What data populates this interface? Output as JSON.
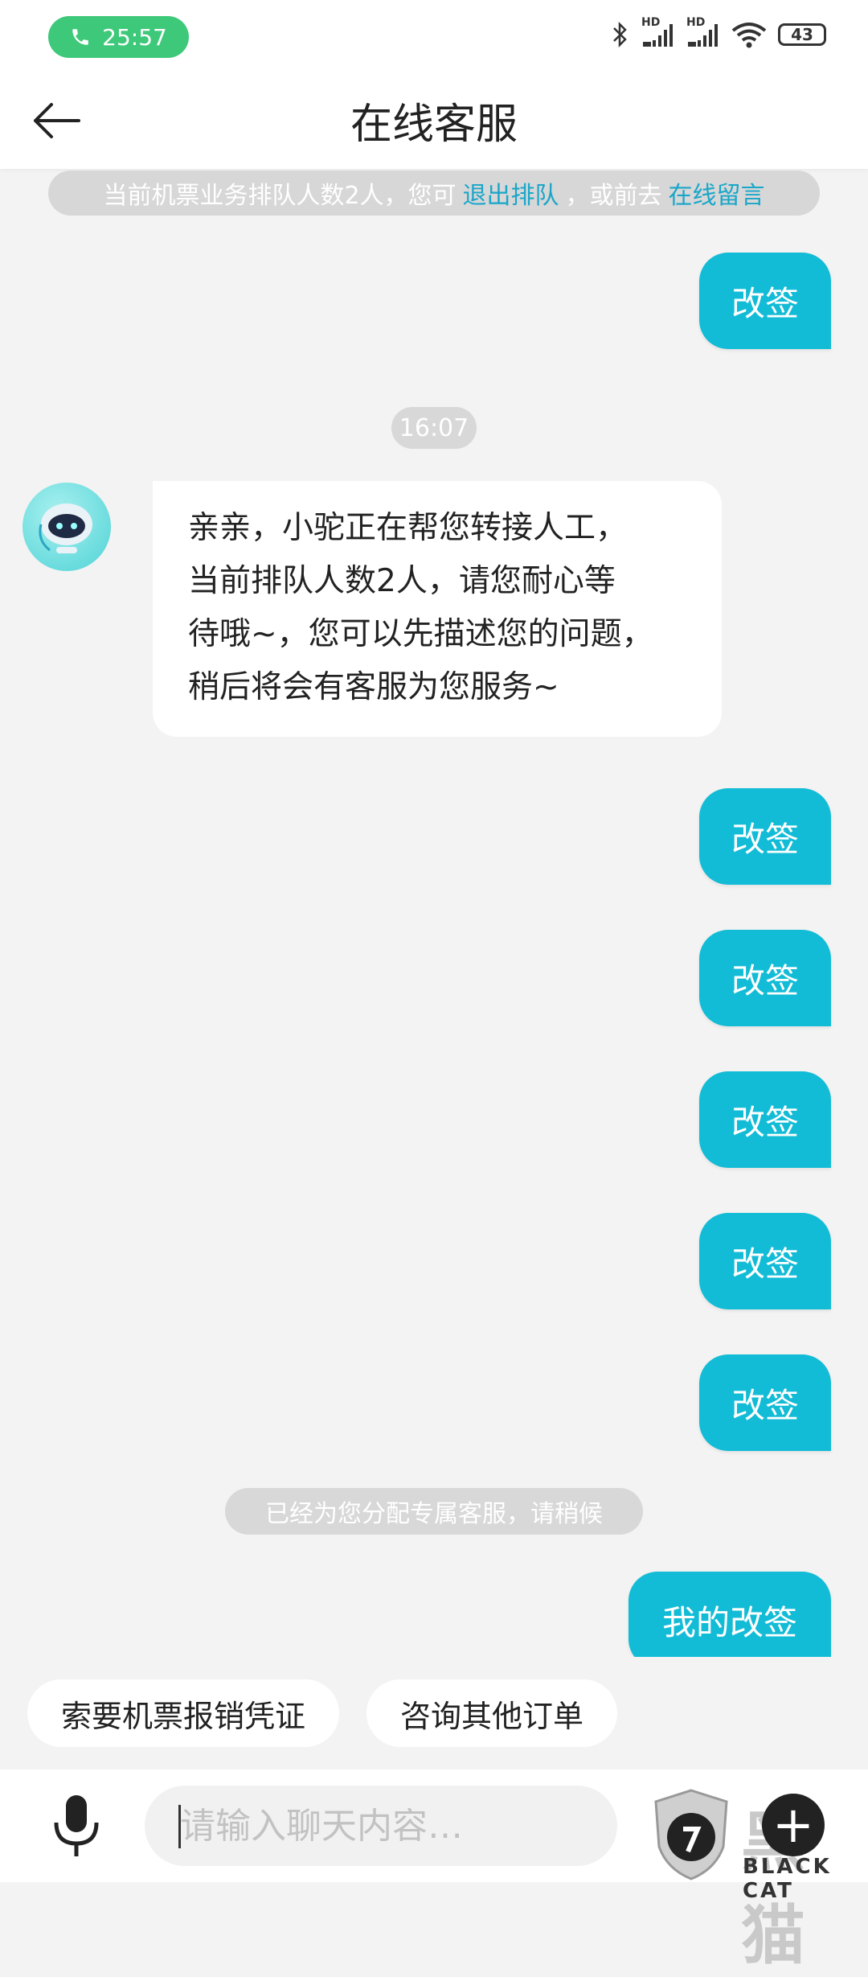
{
  "status_bar": {
    "call_time": "25:57",
    "signal_1": "HD",
    "signal_2": "HD",
    "battery": "43"
  },
  "header": {
    "title": "在线客服"
  },
  "queue_notice": {
    "text_prefix": "当前机票业务排队人数2人，您可",
    "exit_link": "退出排队",
    "text_middle": "，或前去",
    "message_link": "在线留言"
  },
  "messages": {
    "user_1": "改签",
    "timestamp": "16:07",
    "agent_lines": [
      "亲亲，小驼正在帮您转接人工，",
      "当前排队人数2人，请您耐心等",
      "待哦~，您可以先描述您的问题，",
      "稍后将会有客服为您服务~"
    ],
    "user_2": "改签",
    "user_3": "改签",
    "user_4": "改签",
    "user_5": "改签",
    "user_6": "改签",
    "system_notice": "已经为您分配专属客服，请稍候",
    "user_7": "我的改签"
  },
  "quick_replies": [
    "索要机票报销凭证",
    "咨询其他订单"
  ],
  "input": {
    "placeholder": "请输入聊天内容…"
  },
  "watermark": {
    "text": "黑猫",
    "sub": "BLACK CAT"
  },
  "colors": {
    "accent": "#12bcd6",
    "link": "#1aa6c9",
    "call_green": "#3ec97a",
    "background": "#f3f3f3"
  },
  "icons": {
    "back": "arrow-left-icon",
    "call": "phone-icon",
    "mic": "microphone-icon",
    "plus": "plus-icon"
  }
}
